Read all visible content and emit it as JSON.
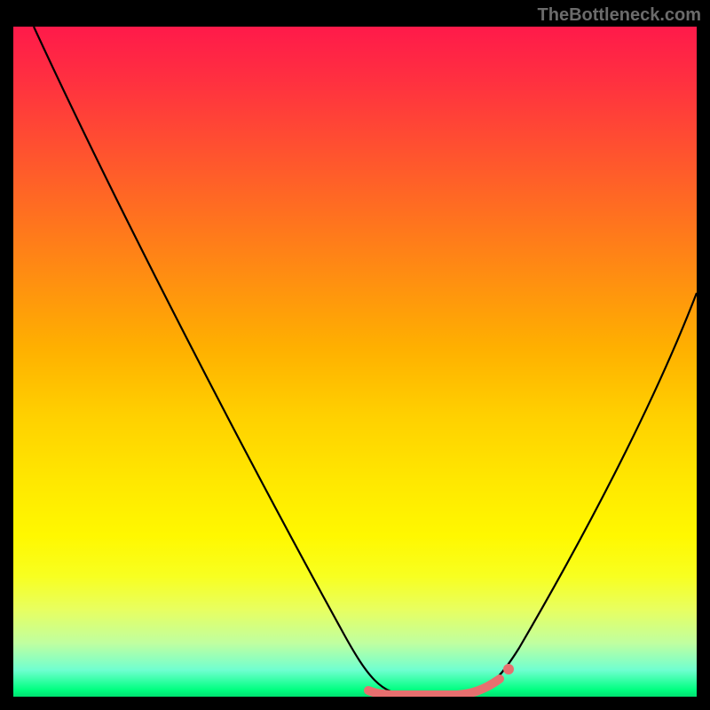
{
  "watermark": "TheBottleneck.com",
  "chart_data": {
    "type": "line",
    "title": "",
    "xlabel": "",
    "ylabel": "",
    "xlim": [
      0,
      100
    ],
    "ylim": [
      0,
      100
    ],
    "series": [
      {
        "name": "curve",
        "x": [
          3,
          10,
          20,
          30,
          40,
          48,
          52,
          55,
          58,
          62,
          65,
          70,
          72,
          80,
          90,
          100
        ],
        "y": [
          100,
          84,
          67,
          50,
          33,
          18,
          8,
          2,
          0,
          0,
          0,
          2,
          5,
          18,
          38,
          60
        ]
      }
    ],
    "marker_region": {
      "x": [
        52,
        72
      ],
      "color": "#e76f6f"
    },
    "gradient_stops": [
      {
        "pos": 0,
        "color": "#ff1a4a"
      },
      {
        "pos": 50,
        "color": "#ffd000"
      },
      {
        "pos": 100,
        "color": "#00e070"
      }
    ]
  }
}
